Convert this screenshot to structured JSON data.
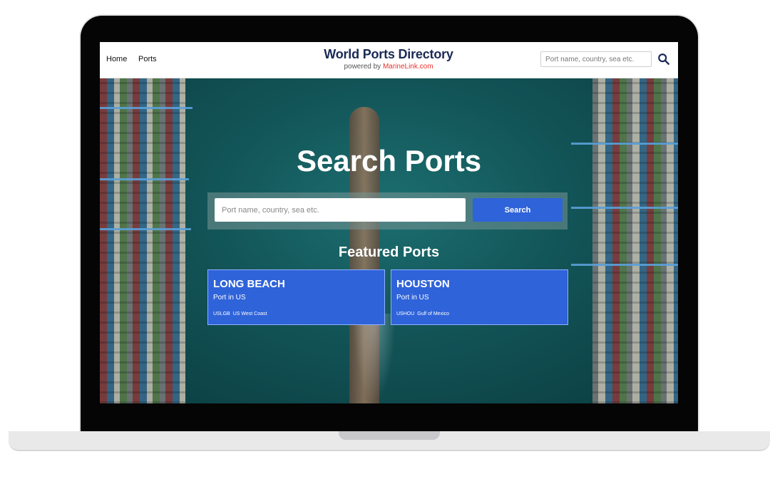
{
  "nav": {
    "links": [
      "Home",
      "Ports"
    ],
    "brand_title": "World Ports Directory",
    "brand_powered": "powered by",
    "brand_accent": "MarineLink.com",
    "search_placeholder": "Port name, country, sea etc.",
    "search_icon": "search-icon"
  },
  "hero": {
    "title": "Search Ports",
    "search_placeholder": "Port name, country, sea etc.",
    "search_button": "Search",
    "featured_title": "Featured Ports"
  },
  "featured_ports": [
    {
      "name": "LONG BEACH",
      "subtitle": "Port in US",
      "code": "USLGB",
      "region": "US West Coast"
    },
    {
      "name": "HOUSTON",
      "subtitle": "Port in US",
      "code": "USHOU",
      "region": "Gulf of Mexico"
    }
  ],
  "colors": {
    "accent": "#2f63d9",
    "brand_navy": "#1a2a55",
    "brand_red": "#e8322b",
    "hero_water": "#125457"
  }
}
